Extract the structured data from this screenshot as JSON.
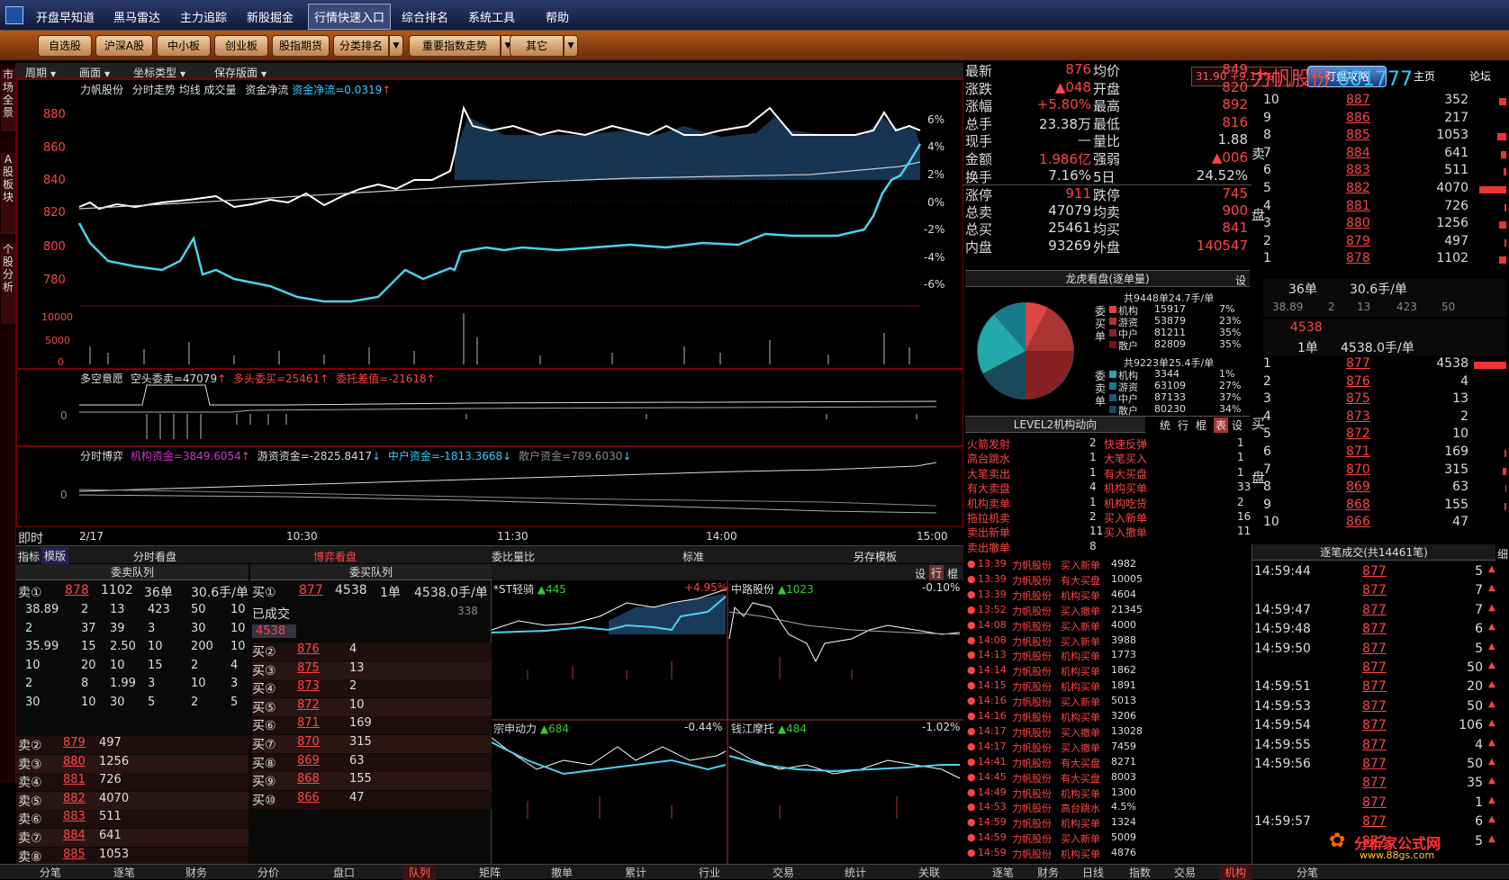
{
  "menu": [
    "开盘早知道",
    "黑马雷达",
    "主力追踪",
    "新股掘金",
    "行情快速入口",
    "综合排名",
    "系统工具",
    "帮助"
  ],
  "toolbar": {
    "buttons": [
      "自选股",
      "沪深A股",
      "中小板",
      "创业板",
      "股指期货",
      "分类排名",
      "重要指数走势",
      "其它"
    ],
    "index_value": "31.90",
    "index_change": "+9.13%",
    "guide": "盯盘攻略",
    "home": "主页",
    "forum": "论坛"
  },
  "left_tabs": [
    "市场全景",
    "A股板块",
    "个股分析"
  ],
  "chart_bar": [
    "周期",
    "画面",
    "坐标类型",
    "保存版面"
  ],
  "main_chart": {
    "title": "力帆股份",
    "labels": [
      "分时走势",
      "均线",
      "成交量",
      "资金净流"
    ],
    "flow_label": "资金净流=0.0319",
    "y_left": [
      "880",
      "860",
      "840",
      "820",
      "800",
      "780"
    ],
    "y_right": [
      "6%",
      "4%",
      "2%",
      "0%",
      "-2%",
      "-4%",
      "-6%"
    ],
    "vol_ticks": [
      "10000",
      "5000",
      "0"
    ],
    "x_labels": [
      "2/17",
      "10:30",
      "11:30",
      "14:00",
      "15:00"
    ]
  },
  "panel2": {
    "title": "多空意愿",
    "a": "空头委卖=47079",
    "b": "多头委买=25461",
    "c": "委托差值=-21618",
    "tick": "0"
  },
  "panel3": {
    "title": "分时博弈",
    "a": "机构资金=3849.6054",
    "b": "游资资金=-2825.8417",
    "c": "中户资金=-1813.3668",
    "d": "散户资金=789.6030",
    "tick": "0"
  },
  "mode": {
    "label": "即时",
    "tabs": [
      "指标",
      "模版",
      "分时看盘",
      "博弈看盘",
      "委比量比",
      "标准",
      "另存模板"
    ]
  },
  "quote": {
    "rows": [
      [
        "最新",
        "876",
        "均价",
        "849"
      ],
      [
        "涨跌",
        "▲048",
        "开盘",
        "820"
      ],
      [
        "涨幅",
        "+5.80%",
        "最高",
        "892"
      ],
      [
        "总手",
        "23.38万",
        "最低",
        "816"
      ],
      [
        "现手",
        "—",
        "量比",
        "1.88"
      ],
      [
        "金额",
        "1.986亿",
        "强弱",
        "▲006"
      ],
      [
        "换手",
        "7.16%",
        "5日",
        "24.52%"
      ],
      [
        "涨停",
        "911",
        "跌停",
        "745"
      ],
      [
        "总卖",
        "47079",
        "均卖",
        "900"
      ],
      [
        "总买",
        "25461",
        "均买",
        "841"
      ],
      [
        "内盘",
        "93269",
        "外盘",
        "140547"
      ]
    ]
  },
  "stock": {
    "name": "力帆股份",
    "code": "601777"
  },
  "sell_book": [
    [
      "10",
      "887",
      "352"
    ],
    [
      "9",
      "886",
      "217"
    ],
    [
      "8",
      "885",
      "1053"
    ],
    [
      "7",
      "884",
      "641"
    ],
    [
      "6",
      "883",
      "511"
    ],
    [
      "5",
      "882",
      "4070"
    ],
    [
      "4",
      "881",
      "726"
    ],
    [
      "3",
      "880",
      "1256"
    ],
    [
      "2",
      "879",
      "497"
    ],
    [
      "1",
      "878",
      "1102"
    ]
  ],
  "sell_info": {
    "orders": "36单",
    "avg": "30.6手/单",
    "queue": [
      "38.89",
      "2",
      "13",
      "423",
      "50"
    ]
  },
  "buy_info": {
    "price": "4538",
    "orders": "1单",
    "avg": "4538.0手/单"
  },
  "buy_book": [
    [
      "1",
      "877",
      "4538"
    ],
    [
      "2",
      "876",
      "4"
    ],
    [
      "3",
      "875",
      "13"
    ],
    [
      "4",
      "873",
      "2"
    ],
    [
      "5",
      "872",
      "10"
    ],
    [
      "6",
      "871",
      "169"
    ],
    [
      "7",
      "870",
      "315"
    ],
    [
      "8",
      "869",
      "63"
    ],
    [
      "9",
      "868",
      "155"
    ],
    [
      "10",
      "866",
      "47"
    ]
  ],
  "side_labels": {
    "sell": "卖",
    "pan": "盘",
    "buy": "买"
  },
  "dragon": {
    "title": "龙虎看盘(逐单量)",
    "set": "设",
    "sell_hdr": "共9448单24.7手/单",
    "buy_hdr": "共9223单25.4手/单",
    "sell_side": "委买单",
    "buy_side": "委卖单",
    "sell_rows": [
      [
        "机构",
        "15917",
        "7%"
      ],
      [
        "游资",
        "53879",
        "23%"
      ],
      [
        "中户",
        "81211",
        "35%"
      ],
      [
        "散户",
        "82809",
        "35%"
      ]
    ],
    "buy_rows": [
      [
        "机构",
        "3344",
        "1%"
      ],
      [
        "游资",
        "63109",
        "27%"
      ],
      [
        "中户",
        "87133",
        "37%"
      ],
      [
        "散户",
        "80230",
        "34%"
      ]
    ]
  },
  "level2": {
    "title": "LEVEL2机构动向",
    "tabs": [
      "统",
      "行",
      "棍",
      "表",
      "设"
    ],
    "rows": [
      [
        "火箭发射",
        "2",
        "快速反弹",
        "1"
      ],
      [
        "高台跳水",
        "1",
        "大笔买入",
        "1"
      ],
      [
        "大笔卖出",
        "1",
        "有大买盘",
        "1"
      ],
      [
        "有大卖盘",
        "4",
        "机构买单",
        "33"
      ],
      [
        "机构卖单",
        "1",
        "机构吃货",
        "2"
      ],
      [
        "拖拉机卖",
        "2",
        "买入新单",
        "16"
      ],
      [
        "卖出新单",
        "11",
        "买入撤单",
        "11"
      ],
      [
        "卖出撤单",
        "8",
        "",
        ""
      ]
    ]
  },
  "events": [
    [
      "13:39",
      "力帆股份",
      "买入新单",
      "4982"
    ],
    [
      "13:39",
      "力帆股份",
      "有大买盘",
      "10005"
    ],
    [
      "13:39",
      "力帆股份",
      "机构买单",
      "4604"
    ],
    [
      "13:52",
      "力帆股份",
      "买入撤单",
      "21345"
    ],
    [
      "14:08",
      "力帆股份",
      "买入新单",
      "4000"
    ],
    [
      "14:08",
      "力帆股份",
      "买入新单",
      "3988"
    ],
    [
      "14:13",
      "力帆股份",
      "机构买单",
      "1773"
    ],
    [
      "14:14",
      "力帆股份",
      "机构买单",
      "1862"
    ],
    [
      "14:15",
      "力帆股份",
      "机构买单",
      "1891"
    ],
    [
      "14:16",
      "力帆股份",
      "买入新单",
      "5013"
    ],
    [
      "14:16",
      "力帆股份",
      "机构买单",
      "3206"
    ],
    [
      "14:17",
      "力帆股份",
      "买入撤单",
      "13028"
    ],
    [
      "14:17",
      "力帆股份",
      "买入撤单",
      "7459"
    ],
    [
      "14:41",
      "力帆股份",
      "有大买盘",
      "8271"
    ],
    [
      "14:45",
      "力帆股份",
      "有大买盘",
      "8003"
    ],
    [
      "14:49",
      "力帆股份",
      "机构买单",
      "1300"
    ],
    [
      "14:53",
      "力帆股份",
      "高台跳水",
      "4.5%"
    ],
    [
      "14:59",
      "力帆股份",
      "机构买单",
      "1324"
    ],
    [
      "14:59",
      "力帆股份",
      "买入新单",
      "5009"
    ],
    [
      "14:59",
      "力帆股份",
      "机构买单",
      "4876"
    ]
  ],
  "ticks": {
    "title": "逐笔成交(共14461笔)",
    "detail": "细",
    "rows": [
      [
        "14:59:44",
        "877",
        "5"
      ],
      [
        "",
        "877",
        "7"
      ],
      [
        "14:59:47",
        "877",
        "7"
      ],
      [
        "14:59:48",
        "877",
        "6"
      ],
      [
        "14:59:50",
        "877",
        "5"
      ],
      [
        "",
        "877",
        "50"
      ],
      [
        "14:59:51",
        "877",
        "20"
      ],
      [
        "14:59:53",
        "877",
        "50"
      ],
      [
        "14:59:54",
        "877",
        "106"
      ],
      [
        "14:59:55",
        "877",
        "4"
      ],
      [
        "14:59:56",
        "877",
        "50"
      ],
      [
        "",
        "877",
        "35"
      ],
      [
        "",
        "877",
        "1"
      ],
      [
        "14:59:57",
        "877",
        "6"
      ],
      [
        "",
        "877",
        "5"
      ]
    ]
  },
  "queue_panel": {
    "sell_hdr": "委卖队列",
    "buy_hdr": "委买队列",
    "sell1": [
      "卖①",
      "878",
      "1102",
      "36单",
      "30.6手/单"
    ],
    "buy1": [
      "买①",
      "877",
      "4538",
      "1单",
      "4538.0手/单"
    ],
    "sell_grid": [
      [
        "38.89",
        "2",
        "13",
        "423",
        "50",
        "10"
      ],
      [
        "2",
        "37",
        "39",
        "3",
        "30",
        "10"
      ],
      [
        "35.99",
        "15",
        "2.50",
        "10",
        "200",
        "10"
      ],
      [
        "10",
        "20",
        "10",
        "15",
        "2",
        "4"
      ],
      [
        "2",
        "8",
        "1.99",
        "3",
        "10",
        "3"
      ],
      [
        "30",
        "10",
        "30",
        "5",
        "2",
        "5"
      ]
    ],
    "done_label": "已成交",
    "done_val": "338",
    "buy_queue_val": "4538",
    "sells": [
      [
        "卖②",
        "879",
        "497"
      ],
      [
        "卖③",
        "880",
        "1256"
      ],
      [
        "卖④",
        "881",
        "726"
      ],
      [
        "卖⑤",
        "882",
        "4070"
      ],
      [
        "卖⑥",
        "883",
        "511"
      ],
      [
        "卖⑦",
        "884",
        "641"
      ],
      [
        "卖⑧",
        "885",
        "1053"
      ]
    ],
    "buys": [
      [
        "买②",
        "876",
        "4"
      ],
      [
        "买③",
        "875",
        "13"
      ],
      [
        "买④",
        "873",
        "2"
      ],
      [
        "买⑤",
        "872",
        "10"
      ],
      [
        "买⑥",
        "871",
        "169"
      ],
      [
        "买⑦",
        "870",
        "315"
      ],
      [
        "买⑧",
        "869",
        "63"
      ],
      [
        "买⑨",
        "868",
        "155"
      ],
      [
        "买⑩",
        "866",
        "47"
      ]
    ]
  },
  "minis": [
    [
      "*ST轻骑",
      "▲445",
      "+4.95%"
    ],
    [
      "中路股份",
      "▲1023",
      "-0.10%"
    ],
    [
      "宗申动力",
      "▲684",
      "-0.44%"
    ],
    [
      "钱江摩托",
      "▲484",
      "-1.02%"
    ]
  ],
  "mini_tools": [
    "设",
    "行",
    "棍"
  ],
  "bottom_tabs": [
    "分笔",
    "逐笔",
    "财务",
    "分价",
    "盘口",
    "队列",
    "矩阵",
    "撤单",
    "累计",
    "行业",
    "交易",
    "统计",
    "关联",
    "逐笔",
    "财务",
    "日线",
    "指数",
    "交易",
    "机构",
    "分笔"
  ],
  "watermark": {
    "text": "分析家公式网",
    "url": "www.88gs.com"
  }
}
